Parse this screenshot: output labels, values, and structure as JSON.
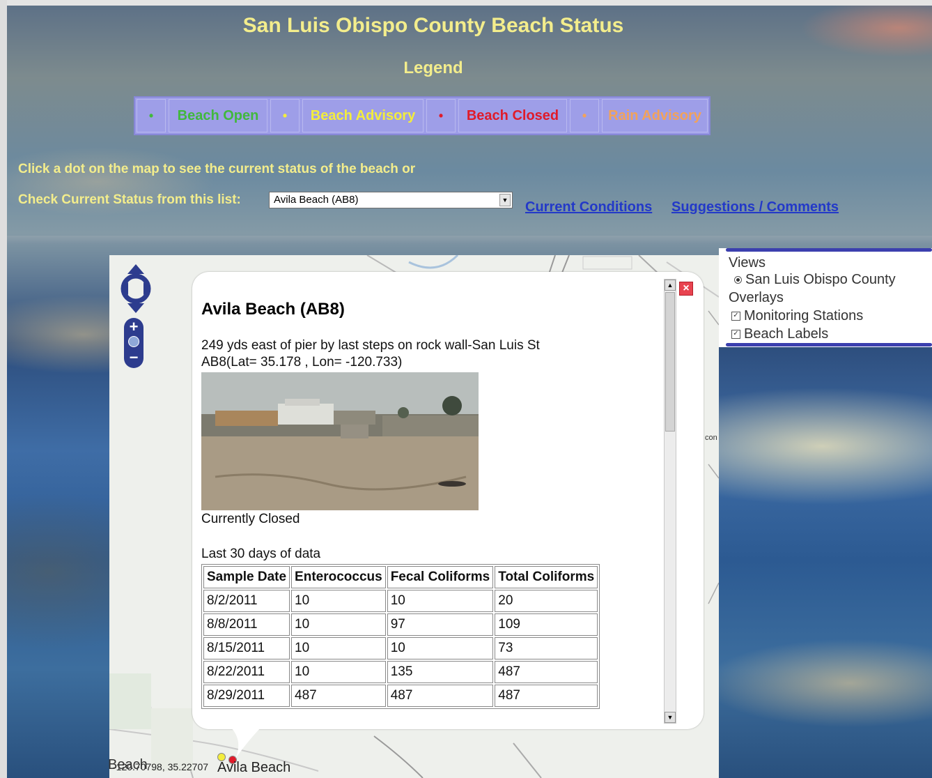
{
  "header": {
    "title": "San Luis Obispo County Beach Status",
    "legend_title": "Legend"
  },
  "legend": [
    {
      "dot": "•",
      "label": "Beach Open",
      "color": "#41b83d"
    },
    {
      "dot": "•",
      "label": "Beach Advisory",
      "color": "#f3ed3c"
    },
    {
      "dot": "•",
      "label": "Beach Closed",
      "color": "#e01b2a"
    },
    {
      "dot": "•",
      "label": "Rain Advisory",
      "color": "#f2a25a"
    }
  ],
  "instructions": {
    "line1": "Click a dot on the map to see the current status of the beach or",
    "line2": "Check Current Status from this list:"
  },
  "station_select": {
    "selected": "Avila Beach (AB8)"
  },
  "links": {
    "current_conditions": "Current Conditions",
    "suggestions": "Suggestions / Comments"
  },
  "popup": {
    "title": "Avila Beach (AB8)",
    "description": "249 yds east of pier by last steps on rock wall-San Luis St",
    "location": "AB8(Lat= 35.178 , Lon= -120.733)",
    "status": "Currently Closed",
    "data_caption": "Last 30 days of data",
    "table": {
      "headers": [
        "Sample Date",
        "Enterococcus",
        "Fecal Coliforms",
        "Total Coliforms"
      ],
      "rows": [
        [
          "8/2/2011",
          "10",
          "10",
          "20"
        ],
        [
          "8/8/2011",
          "10",
          "97",
          "109"
        ],
        [
          "8/15/2011",
          "10",
          "10",
          "73"
        ],
        [
          "8/22/2011",
          "10",
          "135",
          "487"
        ],
        [
          "8/29/2011",
          "487",
          "487",
          "487"
        ]
      ]
    },
    "close_symbol": "×"
  },
  "views_panel": {
    "views_label": "Views",
    "view_option": "San Luis Obispo County",
    "overlays_label": "Overlays",
    "overlay_options": [
      "Monitoring Stations",
      "Beach Labels"
    ],
    "check_mark": "✓"
  },
  "map": {
    "beach_label": "Beach",
    "coordinates": "-120.70798, 35.22707",
    "town_label": "Avila Beach",
    "side_label": "con"
  },
  "zoom": {
    "plus": "+",
    "minus": "−"
  }
}
